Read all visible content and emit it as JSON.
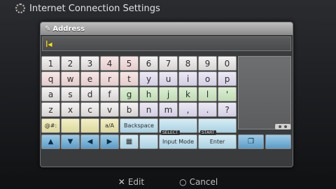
{
  "header": {
    "title": "Internet Connection Settings"
  },
  "dialog": {
    "title": "Address",
    "input_value": ""
  },
  "keyboard": {
    "row_numbers": [
      "1",
      "2",
      "3",
      "4",
      "5",
      "6",
      "7",
      "8",
      "9",
      "0"
    ],
    "row1": [
      "q",
      "w",
      "e",
      "r",
      "t",
      "y",
      "u",
      "i",
      "o",
      "p"
    ],
    "row2": [
      "a",
      "s",
      "d",
      "f",
      "g",
      "h",
      "j",
      "k",
      "l",
      "'"
    ],
    "row3": [
      "z",
      "x",
      "c",
      "v",
      "b",
      "n",
      "m",
      ",",
      ".",
      "?"
    ],
    "mode_key": "@#:",
    "case_key": "a/A",
    "backspace": "Backspace",
    "select_tag": "SELECT",
    "input_mode": "Input Mode",
    "start_tag": "START",
    "enter": "Enter"
  },
  "footer": {
    "edit_symbol": "✕",
    "edit_label": "Edit",
    "cancel_symbol": "○",
    "cancel_label": "Cancel"
  },
  "colors": {
    "number_row": "#f4f2f2",
    "arrow_keys": "#9ccbe6",
    "cursor": "#ffe600"
  }
}
